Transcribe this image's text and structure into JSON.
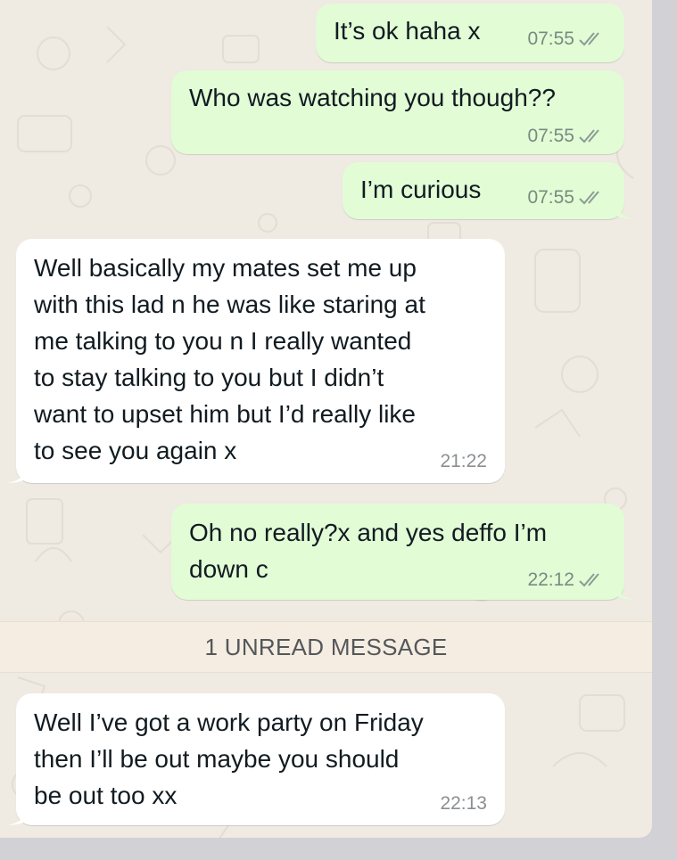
{
  "messages": [
    {
      "direction": "outgoing",
      "text": "It’s ok haha x",
      "time": "07:55",
      "status": "read-ticks-icon"
    },
    {
      "direction": "outgoing",
      "text": "Who was watching you though??",
      "time": "07:55",
      "status": "read-ticks-icon"
    },
    {
      "direction": "outgoing",
      "text": "I’m curious",
      "time": "07:55",
      "status": "read-ticks-icon"
    },
    {
      "direction": "incoming",
      "text": "Well basically my mates set me up\nwith this lad n he was like staring at\nme talking to you n I really wanted\nto stay talking to you but I didn’t\nwant to upset him but I’d really like\nto see you again x",
      "time": "21:22"
    },
    {
      "direction": "outgoing",
      "text": "Oh no really?x and yes deffo I’m\ndown c",
      "time": "22:12",
      "status": "read-ticks-icon"
    },
    {
      "direction": "incoming",
      "text": "Well I’ve got a work party on Friday\nthen I’ll be out maybe you should\nbe out too xx",
      "time": "22:13"
    }
  ],
  "unread_divider": "1 UNREAD MESSAGE",
  "colors": {
    "outgoing_bubble": "#e2fcd6",
    "incoming_bubble": "#ffffff",
    "chat_background": "#efeae2",
    "unread_bar": "#f5ede2"
  }
}
